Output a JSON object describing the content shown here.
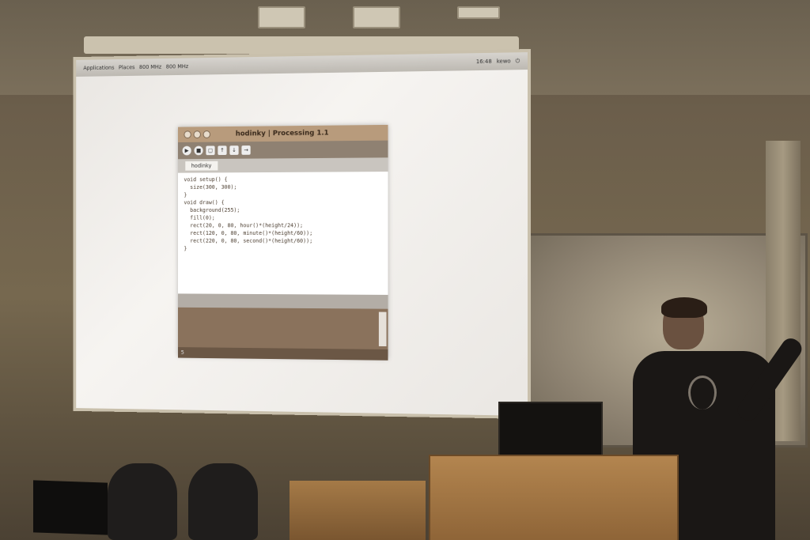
{
  "screen": {
    "os_bar": {
      "menu_applications": "Applications",
      "menu_places": "Places",
      "cpu1": "800 MHz",
      "cpu2": "800 MHz",
      "clock": "16:48",
      "user": "kewo"
    },
    "ide": {
      "window_title": "hodinky | Processing 1.1",
      "tab_label": "hodinky",
      "code_lines": [
        "void setup() {",
        "  size(300, 300);",
        "}",
        "",
        "void draw() {",
        "  background(255);",
        "  fill(0);",
        "  rect(20, 0, 80, hour()*(height/24));",
        "  rect(120, 0, 80, minute()*(height/60));",
        "  rect(220, 0, 80, second()*(height/60));",
        "}"
      ],
      "line_number": "5"
    }
  }
}
